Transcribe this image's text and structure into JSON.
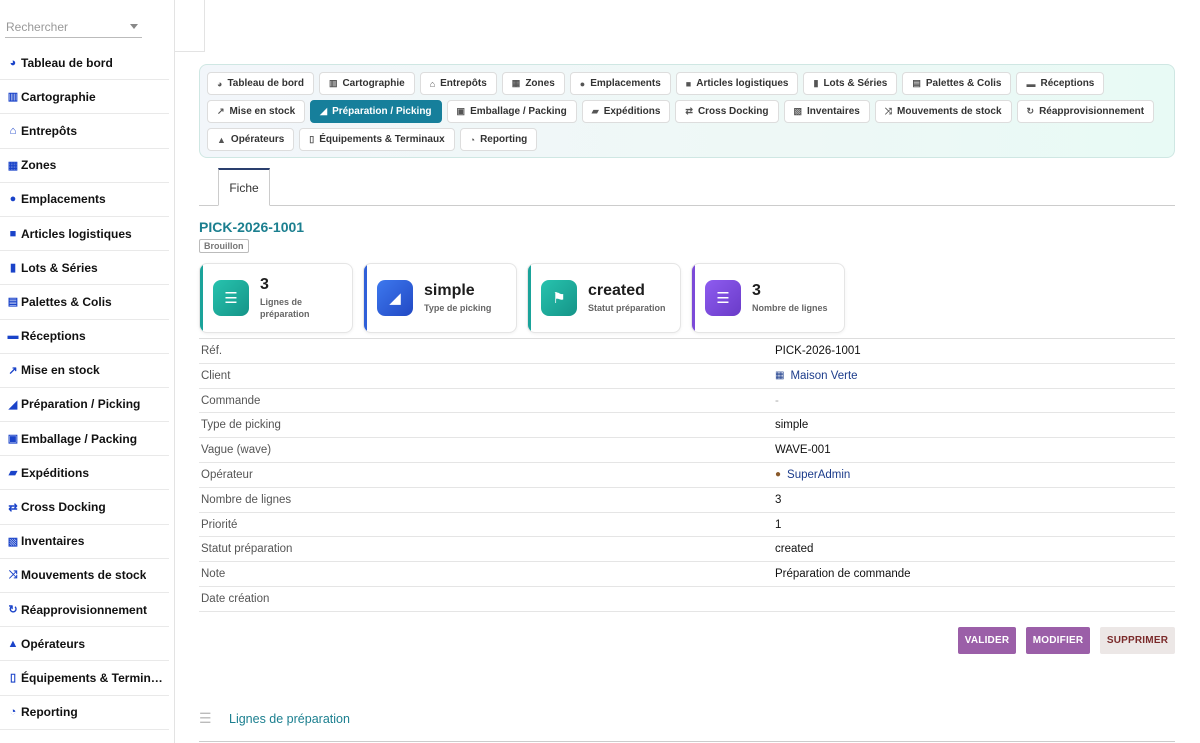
{
  "search": {
    "placeholder": "Rechercher"
  },
  "sidebar": {
    "items": [
      {
        "label": "Tableau de bord",
        "icon": "dashboard-icon",
        "glyph": "◕"
      },
      {
        "label": "Cartographie",
        "icon": "map-icon",
        "glyph": "▥"
      },
      {
        "label": "Entrepôts",
        "icon": "warehouse-icon",
        "glyph": "⌂"
      },
      {
        "label": "Zones",
        "icon": "grid-icon",
        "glyph": "▦"
      },
      {
        "label": "Emplacements",
        "icon": "location-pin-icon",
        "glyph": "●"
      },
      {
        "label": "Articles logistiques",
        "icon": "box-icon",
        "glyph": "■"
      },
      {
        "label": "Lots & Séries",
        "icon": "barcode-icon",
        "glyph": "▮"
      },
      {
        "label": "Palettes & Colis",
        "icon": "pallet-icon",
        "glyph": "▤"
      },
      {
        "label": "Réceptions",
        "icon": "truck-loading-icon",
        "glyph": "▬"
      },
      {
        "label": "Mise en stock",
        "icon": "dolly-icon",
        "glyph": "↗"
      },
      {
        "label": "Préparation / Picking",
        "icon": "hand-holding-icon",
        "glyph": "◢"
      },
      {
        "label": "Emballage / Packing",
        "icon": "boxes-icon",
        "glyph": "▣"
      },
      {
        "label": "Expéditions",
        "icon": "truck-icon",
        "glyph": "▰"
      },
      {
        "label": "Cross Docking",
        "icon": "exchange-icon",
        "glyph": "⇄"
      },
      {
        "label": "Inventaires",
        "icon": "clipboard-check-icon",
        "glyph": "▧"
      },
      {
        "label": "Mouvements de stock",
        "icon": "random-icon",
        "glyph": "⤨"
      },
      {
        "label": "Réapprovisionnement",
        "icon": "sync-icon",
        "glyph": "↻"
      },
      {
        "label": "Opérateurs",
        "icon": "hard-hat-icon",
        "glyph": "▲"
      },
      {
        "label": "Équipements & Terminaux",
        "icon": "mobile-icon",
        "glyph": "▯"
      },
      {
        "label": "Reporting",
        "icon": "chart-pie-icon",
        "glyph": "◔"
      }
    ]
  },
  "nav": {
    "chips": [
      {
        "label": "Tableau de bord",
        "icon": "dashboard-icon",
        "glyph": "◕",
        "active": false
      },
      {
        "label": "Cartographie",
        "icon": "map-icon",
        "glyph": "▥",
        "active": false
      },
      {
        "label": "Entrepôts",
        "icon": "warehouse-icon",
        "glyph": "⌂",
        "active": false
      },
      {
        "label": "Zones",
        "icon": "grid-icon",
        "glyph": "▦",
        "active": false
      },
      {
        "label": "Emplacements",
        "icon": "location-pin-icon",
        "glyph": "●",
        "active": false
      },
      {
        "label": "Articles logistiques",
        "icon": "box-icon",
        "glyph": "■",
        "active": false
      },
      {
        "label": "Lots & Séries",
        "icon": "barcode-icon",
        "glyph": "▮",
        "active": false
      },
      {
        "label": "Palettes & Colis",
        "icon": "pallet-icon",
        "glyph": "▤",
        "active": false
      },
      {
        "label": "Réceptions",
        "icon": "truck-loading-icon",
        "glyph": "▬",
        "active": false
      },
      {
        "label": "Mise en stock",
        "icon": "dolly-icon",
        "glyph": "↗",
        "active": false
      },
      {
        "label": "Préparation / Picking",
        "icon": "hand-holding-icon",
        "glyph": "◢",
        "active": true
      },
      {
        "label": "Emballage / Packing",
        "icon": "boxes-icon",
        "glyph": "▣",
        "active": false
      },
      {
        "label": "Expéditions",
        "icon": "truck-icon",
        "glyph": "▰",
        "active": false
      },
      {
        "label": "Cross Docking",
        "icon": "exchange-icon",
        "glyph": "⇄",
        "active": false
      },
      {
        "label": "Inventaires",
        "icon": "clipboard-check-icon",
        "glyph": "▧",
        "active": false
      },
      {
        "label": "Mouvements de stock",
        "icon": "random-icon",
        "glyph": "⤨",
        "active": false
      },
      {
        "label": "Réapprovisionnement",
        "icon": "sync-icon",
        "glyph": "↻",
        "active": false
      },
      {
        "label": "Opérateurs",
        "icon": "hard-hat-icon",
        "glyph": "▲",
        "active": false
      },
      {
        "label": "Équipements & Terminaux",
        "icon": "mobile-icon",
        "glyph": "▯",
        "active": false
      },
      {
        "label": "Reporting",
        "icon": "chart-pie-icon",
        "glyph": "◔",
        "active": false
      }
    ]
  },
  "tabs": {
    "fiche": "Fiche"
  },
  "record": {
    "ref": "PICK-2026-1001",
    "status_badge": "Brouillon"
  },
  "cards": [
    {
      "value": "3",
      "label": "Lignes de préparation",
      "icon": "list-icon",
      "glyph": "☰",
      "accent": "#1aa39a",
      "grad_from": "#27c3ae",
      "grad_to": "#159488"
    },
    {
      "value": "simple",
      "label": "Type de picking",
      "icon": "hand-holding-icon",
      "glyph": "◢",
      "accent": "#2f5fd8",
      "grad_from": "#3d78ee",
      "grad_to": "#2249c4"
    },
    {
      "value": "created",
      "label": "Statut préparation",
      "icon": "flag-icon",
      "glyph": "⚑",
      "accent": "#1aa39a",
      "grad_from": "#27c3ae",
      "grad_to": "#159488"
    },
    {
      "value": "3",
      "label": "Nombre de lignes",
      "icon": "list-icon",
      "glyph": "☰",
      "accent": "#7c4ad8",
      "grad_from": "#8e5cf0",
      "grad_to": "#6a3bc8"
    }
  ],
  "details": [
    {
      "key": "Réf.",
      "value": "PICK-2026-1001"
    },
    {
      "key": "Client",
      "value": "Maison Verte",
      "icon": "building-icon",
      "glyph": "▦",
      "link": true
    },
    {
      "key": "Commande",
      "value": "-",
      "muted": true
    },
    {
      "key": "Type de picking",
      "value": "simple"
    },
    {
      "key": "Vague (wave)",
      "value": "WAVE-001"
    },
    {
      "key": "Opérateur",
      "value": "SuperAdmin",
      "icon": "user-icon",
      "glyph": "●",
      "link": true
    },
    {
      "key": "Nombre de lignes",
      "value": "3"
    },
    {
      "key": "Priorité",
      "value": "1"
    },
    {
      "key": "Statut préparation",
      "value": "created"
    },
    {
      "key": "Note",
      "value": "Préparation de commande"
    },
    {
      "key": "Date création",
      "value": ""
    }
  ],
  "actions": {
    "validate": "VALIDER",
    "modify": "MODIFIER",
    "delete": "SUPPRIMER"
  },
  "lines_section": {
    "title": "Lignes de préparation",
    "icon": "list-icon"
  },
  "colors": {
    "accent_teal": "#1b7f8f",
    "active_chip": "#167f9b",
    "action_purple": "#9b5fa8",
    "sidebar_icon": "#1a43c9"
  }
}
